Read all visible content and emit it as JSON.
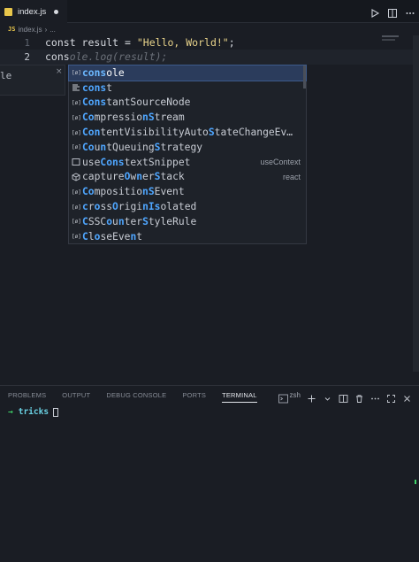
{
  "tab": {
    "filename": "index.js",
    "dirty": true
  },
  "breadcrumb": {
    "file": "index.js",
    "more": "..."
  },
  "editor": {
    "lines": [
      {
        "number": "1",
        "code_kw": "const",
        "code_mid": " result = ",
        "code_str": "\"Hello, World!\"",
        "code_end": ";"
      },
      {
        "number": "2",
        "typed": "cons",
        "ghost": "ole.log(result);"
      }
    ],
    "hover_fragment": {
      "text": "le",
      "close": "×"
    }
  },
  "suggest": {
    "items": [
      {
        "icon": "variable-icon",
        "pre": "",
        "match": "cons",
        "post": "ole",
        "detail": "",
        "selected": true
      },
      {
        "icon": "keyword-icon",
        "pre": "",
        "match": "cons",
        "post": "t",
        "detail": ""
      },
      {
        "icon": "variable-icon",
        "pre": "",
        "match": "Cons",
        "post": "tantSourceNode",
        "detail": ""
      },
      {
        "icon": "variable-icon",
        "pre": "",
        "match": "Co",
        "post": "mpressio",
        "match2": "nS",
        "post2": "tream",
        "detail": ""
      },
      {
        "icon": "variable-icon",
        "pre": "",
        "match": "Con",
        "post": "tentVisibilityAuto",
        "match2": "S",
        "post2": "tateChangeEv…",
        "detail": ""
      },
      {
        "icon": "variable-icon",
        "pre": "",
        "match": "Co",
        "post": "u",
        "match2": "n",
        "post2": "tQueuing",
        "match3": "S",
        "post3": "trategy",
        "detail": ""
      },
      {
        "icon": "snippet-icon",
        "pre": "use",
        "match": "Cons",
        "post": "",
        "pre2": "",
        "post2": "",
        "full": "useContextSnippet",
        "detail": "useContext"
      },
      {
        "icon": "package-icon",
        "pre": "",
        "match": "",
        "post": "",
        "full": "captureOwnerStack",
        "detail": "react"
      },
      {
        "icon": "variable-icon",
        "full": "CompositionEvent",
        "detail": ""
      },
      {
        "icon": "variable-icon",
        "full": "crossOriginIsolated",
        "detail": ""
      },
      {
        "icon": "variable-icon",
        "full": "CSSCounterStyleRule",
        "detail": ""
      },
      {
        "icon": "variable-icon",
        "full": "CloseEvent",
        "detail": ""
      }
    ],
    "labels": {
      "i0": "console",
      "i1": "const",
      "i2": "ConstantSourceNode",
      "i3": "CompressionStream",
      "i4": "ContentVisibilityAutoStateChangeEv…",
      "i5": "CountQueuingStrategy",
      "i6": "useContextSnippet",
      "i7": "captureOwnerStack",
      "i8": "CompositionEvent",
      "i9": "crossOriginIsolated",
      "i10": "CSSCounterStyleRule",
      "i11": "CloseEvent"
    },
    "details": {
      "i6": "useContext",
      "i7": "react"
    }
  },
  "panel": {
    "tabs": [
      "PROBLEMS",
      "OUTPUT",
      "DEBUG CONSOLE",
      "PORTS",
      "TERMINAL"
    ],
    "active_tab": "TERMINAL",
    "shell": "zsh",
    "terminal": {
      "arrow": "→",
      "dir": "tricks"
    }
  },
  "colors": {
    "accent": "#4fa6ff",
    "selection": "#2b3c5c",
    "string": "#e8d38a",
    "terminal_green": "#3fd46a",
    "terminal_cyan": "#6ad1e3"
  }
}
